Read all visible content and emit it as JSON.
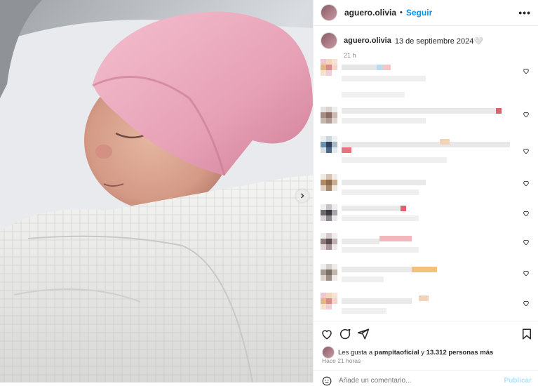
{
  "post": {
    "username": "aguero.olivia",
    "separator": "•",
    "follow_label": "Seguir",
    "more_label": "•••"
  },
  "caption": {
    "username": "aguero.olivia",
    "date": "13 de septiembre 2024🤍",
    "time": "21 h"
  },
  "likes": {
    "prefix": "Les gusta a",
    "user": "pampitaoficial",
    "connector": "y",
    "count": "13.312 personas más"
  },
  "ago": "Hace 21 horas",
  "add_comment": {
    "placeholder": "Añade un comentario...",
    "publish_label": "Publicar"
  },
  "icons": {
    "like": "heart-icon",
    "comment": "comment-icon",
    "share": "share-icon",
    "save": "bookmark-icon",
    "next": "chevron-right-icon",
    "emoji": "emoji-icon"
  },
  "colors": {
    "accent": "#0095f6",
    "hat": "#e8a3b8",
    "blanket": "#efefef"
  }
}
